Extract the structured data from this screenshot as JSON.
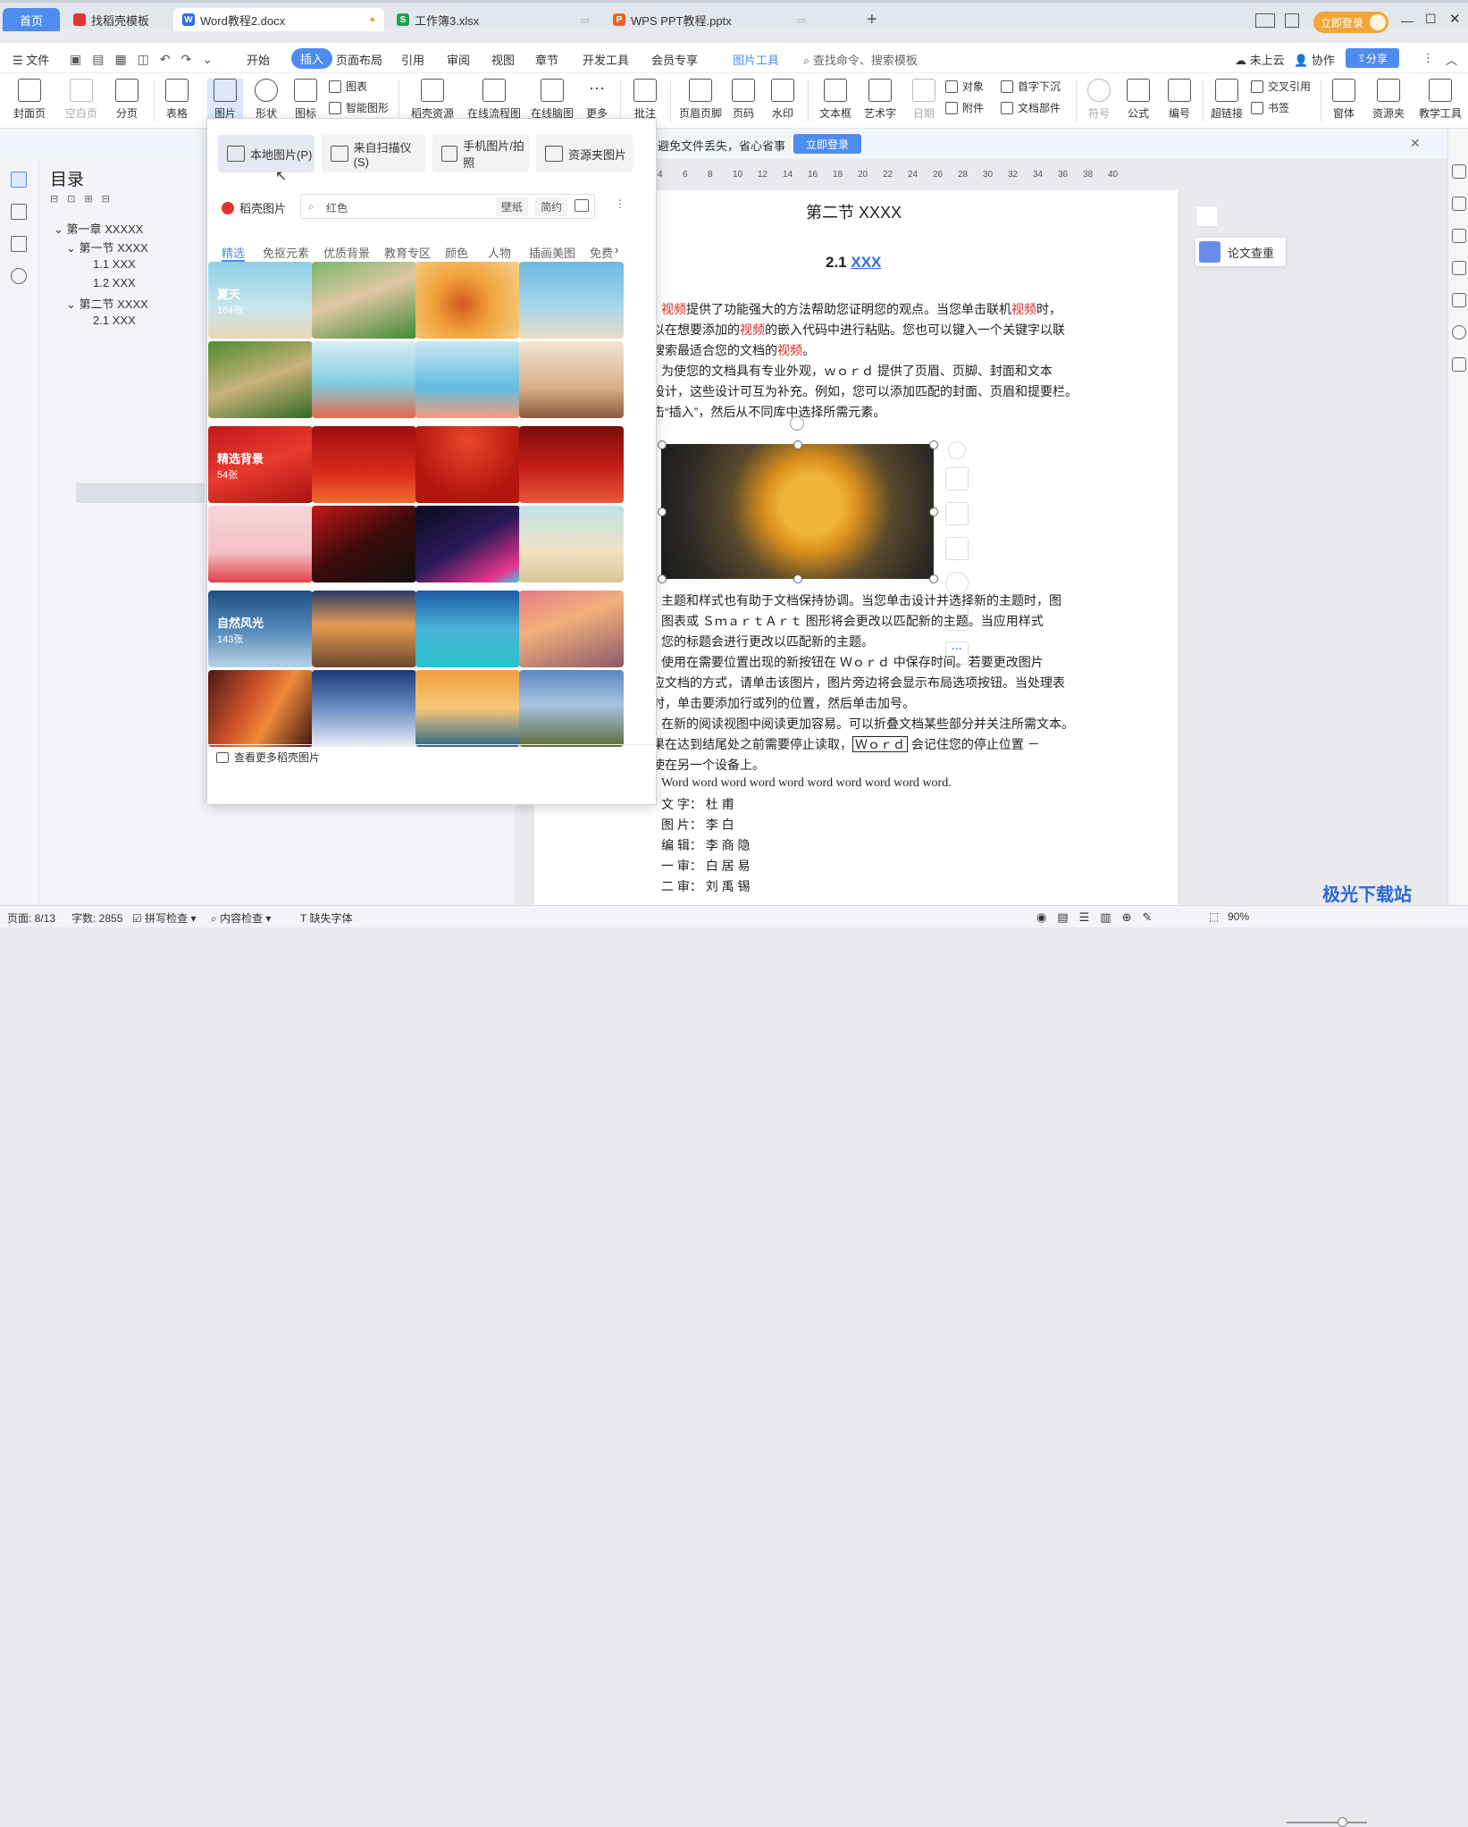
{
  "tabs": [
    {
      "label": "首页"
    },
    {
      "label": "找稻壳模板",
      "icon": "docer-icon",
      "color": "#e0332d"
    },
    {
      "label": "Word教程2.docx",
      "icon": "word-icon",
      "color": "#2b6de6"
    },
    {
      "label": "工作簿3.xlsx",
      "icon": "excel-icon",
      "color": "#1fa05a"
    },
    {
      "label": "WPS PPT教程.pptx",
      "icon": "ppt-icon",
      "color": "#e8642c"
    }
  ],
  "titlebar": {
    "login": "立即登录"
  },
  "menubar": {
    "file": "文件",
    "items": [
      "开始",
      "插入",
      "页面布局",
      "引用",
      "审阅",
      "视图",
      "章节",
      "开发工具",
      "会员专享"
    ],
    "active": "插入",
    "picture_tools": "图片工具",
    "search": "查找命令、搜索模板",
    "cloud": "未上云",
    "collab": "协作",
    "share": "分享"
  },
  "ribbon": {
    "cover": "封面页",
    "blank": "空白页",
    "pagebreak": "分页",
    "table": "表格",
    "picture": "图片",
    "shape": "形状",
    "icon": "图标",
    "chart": "图表",
    "smartart": "智能图形",
    "docer_res": "稻壳资源",
    "flowchart": "在线流程图",
    "mindmap": "在线脑图",
    "more": "更多",
    "comment": "批注",
    "header_footer": "页眉页脚",
    "page_num": "页码",
    "watermark": "水印",
    "textbox": "文本框",
    "wordart": "艺术字",
    "date": "日期",
    "object": "对象",
    "dropcap": "首字下沉",
    "attach": "附件",
    "docpart": "文档部件",
    "symbol": "符号",
    "formula": "公式",
    "numbering": "编号",
    "hyperlink": "超链接",
    "crossref": "交叉引用",
    "bookmark": "书签",
    "form": "窗体",
    "resource": "资源夹",
    "teach": "教学工具"
  },
  "notice": {
    "text": "避免文件丢失，省心省事",
    "button": "立即登录"
  },
  "toc": {
    "title": "目录",
    "items": [
      {
        "label": "第一章 XXXXX"
      },
      {
        "label": "第一节 XXXX"
      },
      {
        "label": "1.1 XXX"
      },
      {
        "label": "1.2 XXX"
      },
      {
        "label": "第二节 XXXX"
      },
      {
        "label": "2.1 XXX"
      }
    ]
  },
  "dropdown": {
    "buttons": [
      "本地图片(P)",
      "来自扫描仪(S)",
      "手机图片/拍照",
      "资源夹图片"
    ],
    "brand": "稻壳图片",
    "search_value": "红色",
    "tag1": "壁纸",
    "tag2": "简约",
    "categories": [
      "精选",
      "免抠元素",
      "优质背景",
      "教育专区",
      "颜色",
      "人物",
      "插画美图",
      "免费"
    ],
    "groups": [
      {
        "title": "夏天",
        "count": "164张"
      },
      {
        "title": "精选背景",
        "count": "54张"
      },
      {
        "title": "自然风光",
        "count": "143张"
      }
    ],
    "footer": "查看更多稻壳图片"
  },
  "doc": {
    "heading": "第二节  XXXX",
    "subheading_num": "2.1",
    "subheading_link": "XXX",
    "p1a": "视频",
    "p1b": "提供了功能强大的方法帮助您证明您的观点。当您单击联机",
    "p1c": "视频",
    "p1d": "时，",
    "p2a": "以在想要添加的",
    "p2b": "视频",
    "p2c": "的嵌入代码中进行粘贴。您也可以键入一个关键字以联",
    "p3a": "搜索最适合您的文档的",
    "p3b": "视频",
    "p3c": "。",
    "p4": "为使您的文档具有专业外观，ｗｏｒｄ  提供了页眉、页脚、封面和文本",
    "p5": "设计，这些设计可互为补充。例如，您可以添加匹配的封面、页眉和提要栏。",
    "p6": "击“插入”，然后从不同库中选择所需元素。",
    "p7": "主题和样式也有助于文档保持协调。当您单击设计并选择新的主题时，图",
    "p8": "图表或 ＳｍａｒｔＡｒｔ  图形将会更改以匹配新的主题。当应用样式",
    "p9": "您的标题会进行更改以匹配新的主题。",
    "p10": "使用在需要位置出现的新按钮在 Ｗｏｒｄ 中保存时间。若要更改图片",
    "p11": "应文档的方式，请单击该图片，图片旁边将会显示布局选项按钮。当处理表",
    "p12": "时，单击要添加行或列的位置，然后单击加号。",
    "p13": "在新的阅读视图中阅读更加容易。可以折叠文档某些部分并关注所需文本。",
    "p14a": "果在达到结尾处之前需要停止读取，",
    "p14b": "Ｗｏｒｄ",
    "p14c": " 会记住您的停止位置 －",
    "p15": "使在另一个设备上。",
    "p16": "Word word word word word word word word word word.",
    "credits": [
      {
        "role": "文 字：",
        "name": "杜   甫"
      },
      {
        "role": "图 片：",
        "name": "李   白"
      },
      {
        "role": "编 辑：",
        "name": "李 商 隐"
      },
      {
        "role": "一 审：",
        "name": "白 居 易"
      },
      {
        "role": "二 审：",
        "name": "刘 禹 锡"
      }
    ]
  },
  "ruler_ticks": [
    "4",
    "6",
    "8",
    "10",
    "12",
    "14",
    "16",
    "18",
    "20",
    "22",
    "24",
    "26",
    "28",
    "30",
    "32",
    "34",
    "36",
    "38",
    "40"
  ],
  "side_check": "论文查重",
  "statusbar": {
    "page": "页面: 8/13",
    "words": "字数: 2855",
    "spell": "拼写检查",
    "content": "内容检查",
    "font": "缺失字体",
    "zoom": "90%"
  },
  "watermark": "极光下载站"
}
